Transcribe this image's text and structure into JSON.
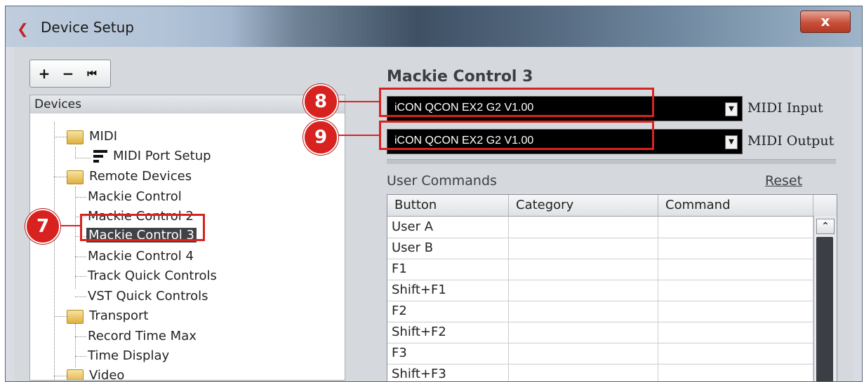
{
  "window": {
    "title": "Device Setup",
    "close_label": "x"
  },
  "toolbar": {
    "add_label": "+",
    "remove_label": "−",
    "reset_label": "⏮"
  },
  "devices_panel": {
    "header": "Devices",
    "tree": [
      {
        "label": "MIDI",
        "level": 0,
        "icon": "folder-icon"
      },
      {
        "label": "MIDI Port Setup",
        "level": 1,
        "icon": "midi-port-icon"
      },
      {
        "label": "Remote Devices",
        "level": 0,
        "icon": "folder-icon"
      },
      {
        "label": "Mackie Control",
        "level": 1
      },
      {
        "label": "Mackie Control 2",
        "level": 1
      },
      {
        "label": "Mackie Control 3",
        "level": 1,
        "selected": true
      },
      {
        "label": "Mackie Control 4",
        "level": 1
      },
      {
        "label": "Track Quick Controls",
        "level": 1
      },
      {
        "label": "VST Quick Controls",
        "level": 1
      },
      {
        "label": "Transport",
        "level": 0,
        "icon": "folder-icon"
      },
      {
        "label": "Record Time Max",
        "level": 1
      },
      {
        "label": "Time Display",
        "level": 1
      },
      {
        "label": "Video",
        "level": 0,
        "icon": "folder-icon"
      }
    ]
  },
  "detail": {
    "title": "Mackie Control 3",
    "midi_input": {
      "value": "iCON QCON EX2 G2 V1.00",
      "label": "MIDI Input"
    },
    "midi_output": {
      "value": "iCON QCON EX2 G2 V1.00",
      "label": "MIDI Output"
    },
    "user_commands_label": "User Commands",
    "reset_label": "Reset",
    "columns": [
      "Button",
      "Category",
      "Command"
    ],
    "rows": [
      {
        "button": "User A",
        "category": "",
        "command": ""
      },
      {
        "button": "User B",
        "category": "",
        "command": ""
      },
      {
        "button": "F1",
        "category": "",
        "command": ""
      },
      {
        "button": "Shift+F1",
        "category": "",
        "command": ""
      },
      {
        "button": "F2",
        "category": "",
        "command": ""
      },
      {
        "button": "Shift+F2",
        "category": "",
        "command": ""
      },
      {
        "button": "F3",
        "category": "",
        "command": ""
      },
      {
        "button": "Shift+F3",
        "category": "",
        "command": ""
      }
    ]
  },
  "callouts": {
    "seven": "7",
    "eight": "8",
    "nine": "9",
    "color": "#d8221f"
  },
  "colors": {
    "midi_field_bg": "#000000",
    "scroll_thumb": "#3b3f45"
  }
}
